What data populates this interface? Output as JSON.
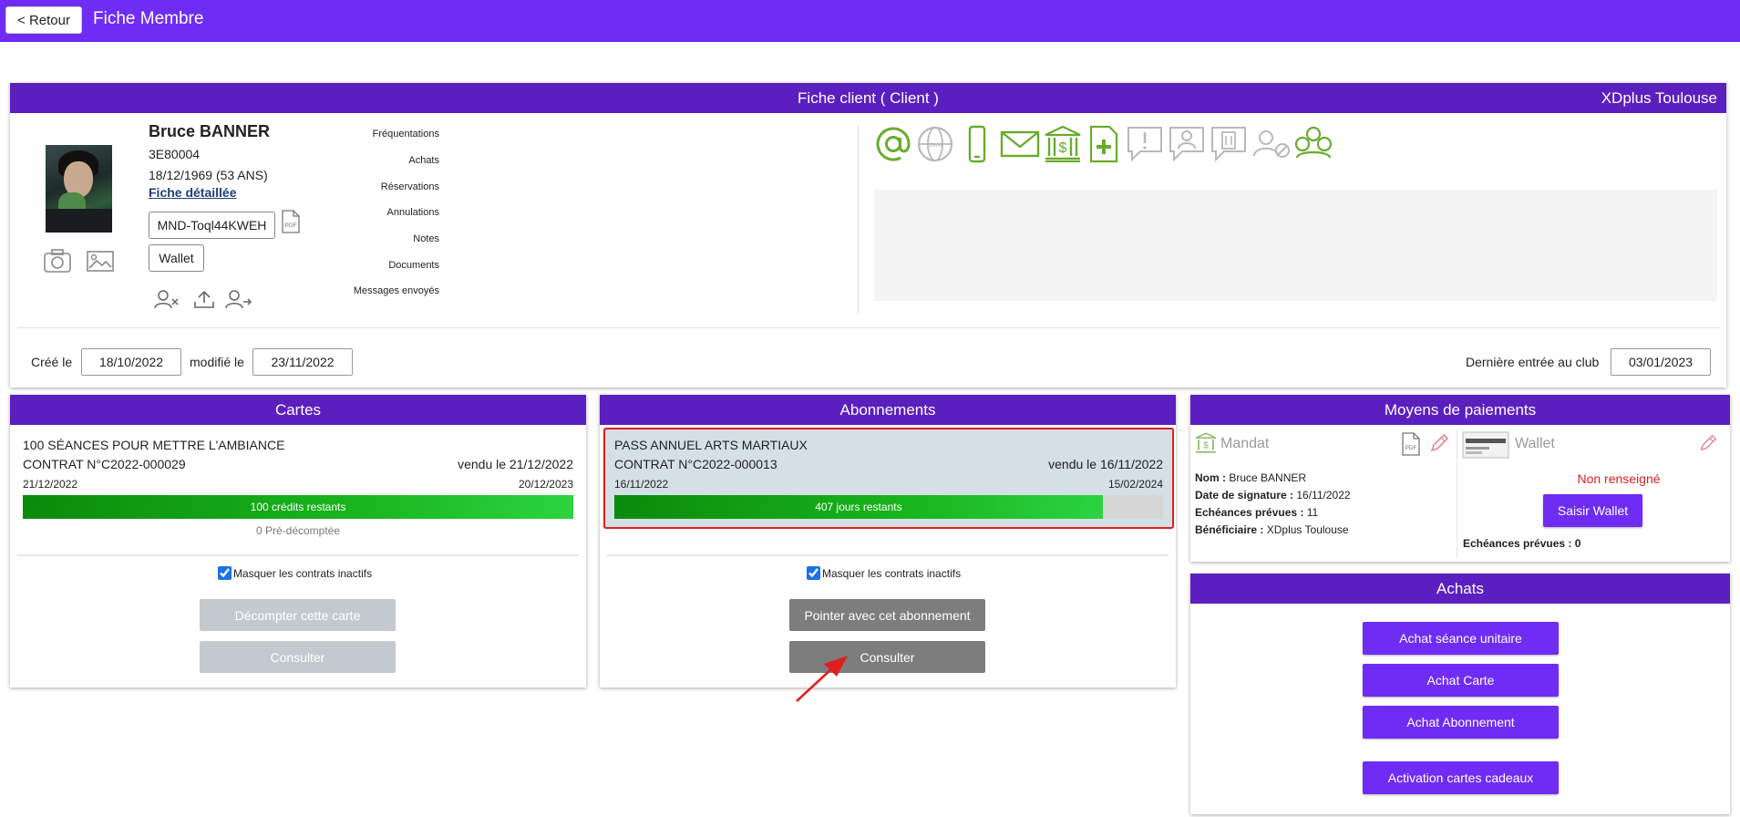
{
  "topbar": {
    "back_label": "< Retour",
    "title": "Fiche Membre"
  },
  "client": {
    "header_title": "Fiche client ( Client )",
    "club": "XDplus Toulouse",
    "name": "Bruce BANNER",
    "code": "3E80004",
    "birth": "18/12/1969 (53 ANS)",
    "detail_link": "Fiche détaillée",
    "mandate_ref": "MND-Toql44KWEH",
    "wallet_label": "Wallet",
    "menu": [
      "Fréquentations",
      "Achats",
      "Réservations",
      "Annulations",
      "Notes",
      "Documents",
      "Messages envoyés"
    ],
    "created_label": "Créé le",
    "created_date": "18/10/2022",
    "modified_label": "modifié le",
    "modified_date": "23/11/2022",
    "last_entry_label": "Dernière entrée au club",
    "last_entry_date": "03/01/2023"
  },
  "contact_icons": [
    {
      "name": "at-icon",
      "color": "#6aab2e"
    },
    {
      "name": "globe-icon",
      "color": "#b9b9b9"
    },
    {
      "name": "mobile-icon",
      "color": "#6aab2e"
    },
    {
      "name": "mail-icon",
      "color": "#6aab2e"
    },
    {
      "name": "bank-icon",
      "color": "#6aab2e"
    },
    {
      "name": "medical-doc-icon",
      "color": "#6aab2e"
    },
    {
      "name": "alert-bubble-icon",
      "color": "#b9b9b9"
    },
    {
      "name": "user-bubble-icon",
      "color": "#b9b9b9"
    },
    {
      "name": "company-bubble-icon",
      "color": "#b9b9b9"
    },
    {
      "name": "user-blocked-icon",
      "color": "#b9b9b9"
    },
    {
      "name": "group-icon",
      "color": "#6aab2e"
    }
  ],
  "cartes": {
    "title": "Cartes",
    "item_name": "100 SÉANCES POUR METTRE L'AMBIANCE",
    "contract": "CONTRAT N°C2022-000029",
    "sold": "vendu le 21/12/2022",
    "start": "21/12/2022",
    "end": "20/12/2023",
    "remaining_label": "100 crédits restants",
    "remaining_fraction": 1.0,
    "pre_count": "0 Pré-décomptée",
    "mask_label": "Masquer les contrats inactifs",
    "btn_decount": "Décompter cette carte",
    "btn_consult": "Consulter"
  },
  "abonnements": {
    "title": "Abonnements",
    "item_name": "PASS ANNUEL ARTS MARTIAUX",
    "contract": "CONTRAT N°C2022-000013",
    "sold": "vendu le 16/11/2022",
    "start": "16/11/2022",
    "end": "15/02/2024",
    "remaining_label": "407 jours restants",
    "remaining_fraction": 0.89,
    "mask_label": "Masquer les contrats inactifs",
    "btn_pointer": "Pointer avec cet abonnement",
    "btn_consult": "Consulter"
  },
  "paiements": {
    "title": "Moyens de paiements",
    "mandat_label": "Mandat",
    "nom_label": "Nom :",
    "nom_value": "Bruce BANNER",
    "sig_label": "Date de signature :",
    "sig_value": "16/11/2022",
    "ech_label": "Echéances prévues :",
    "ech_value": "11",
    "benef_label": "Bénéficiaire :",
    "benef_value": "XDplus Toulouse",
    "wallet_label": "Wallet",
    "wallet_status": "Non renseigné",
    "wallet_btn": "Saisir Wallet",
    "wallet_ech_label": "Echéances prévues :",
    "wallet_ech_value": "0"
  },
  "achats": {
    "title": "Achats",
    "btn_seance": "Achat séance unitaire",
    "btn_carte": "Achat Carte",
    "btn_abonnement": "Achat Abonnement",
    "btn_cadeaux": "Activation cartes cadeaux"
  },
  "colors": {
    "topbar": "#6f2cf5",
    "panel_header": "#5b1fc0",
    "accent_button": "#6f2cf5",
    "icon_green": "#6aab2e",
    "icon_grey": "#b9b9b9",
    "status_red": "#e01e1e"
  }
}
